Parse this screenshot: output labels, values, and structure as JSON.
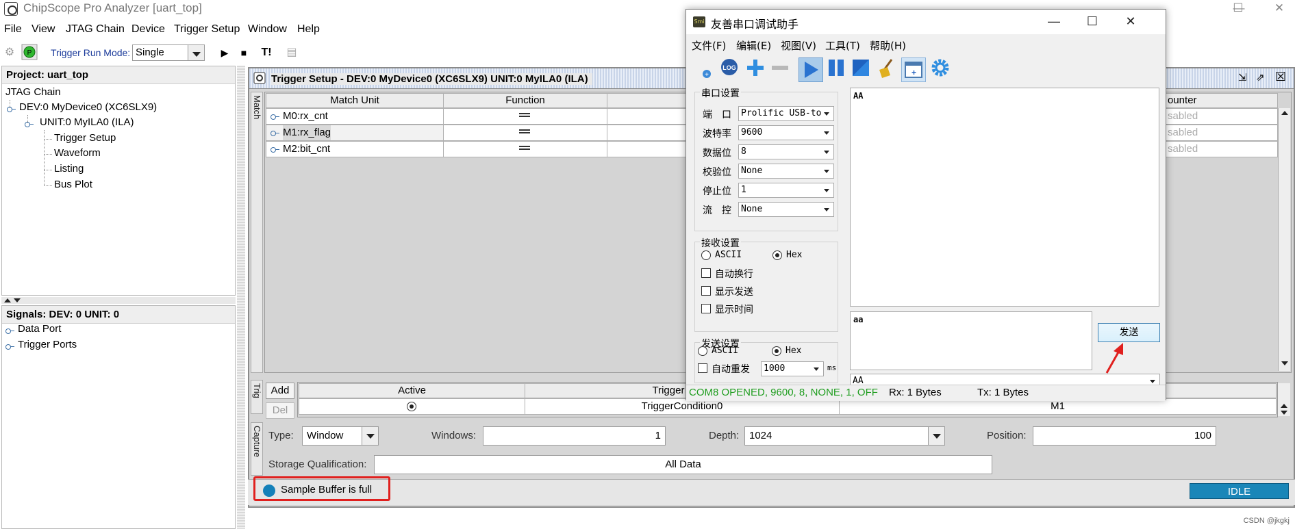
{
  "window": {
    "title": "ChipScope Pro Analyzer [uart_top]",
    "minimize": "—",
    "maximize": "☐",
    "close": "✕"
  },
  "menu": [
    "File",
    "View",
    "JTAG Chain",
    "Device",
    "Trigger Setup",
    "Window",
    "Help"
  ],
  "toolbar": {
    "trigger_mode_label": "Trigger Run Mode:",
    "trigger_mode_value": "Single",
    "run_icon": "▶",
    "stop_icon": "■",
    "trigger_now_label": "T!"
  },
  "project": {
    "header": "Project: uart_top",
    "tree": [
      "JTAG Chain",
      "DEV:0 MyDevice0 (XC6SLX9)",
      "UNIT:0 MyILA0 (ILA)",
      "Trigger Setup",
      "Waveform",
      "Listing",
      "Bus Plot"
    ]
  },
  "signals": {
    "header": "Signals: DEV: 0 UNIT: 0",
    "items": [
      "Data Port",
      "Trigger Ports"
    ]
  },
  "trigger_setup": {
    "title": "Trigger Setup - DEV:0 MyDevice0 (XC6SLX9) UNIT:0 MyILA0 (ILA)",
    "tab_match": "Match",
    "tab_trig": "Trig",
    "tab_capture": "Capture",
    "match_headers": [
      "Match Unit",
      "Function",
      "ounter"
    ],
    "match_rows": [
      {
        "unit": "M0:rx_cnt",
        "counter": "sabled"
      },
      {
        "unit": "M1:rx_flag",
        "counter": "sabled"
      },
      {
        "unit": "M2:bit_cnt",
        "counter": "sabled"
      }
    ],
    "add": "Add",
    "del": "Del",
    "trig_headers": [
      "Active",
      "Trigger Cond"
    ],
    "trig_row": {
      "condition": "TriggerCondition0",
      "equation": "M1"
    },
    "capture": {
      "type_label": "Type:",
      "type_value": "Window",
      "windows_label": "Windows:",
      "windows_value": "1",
      "depth_label": "Depth:",
      "depth_value": "1024",
      "position_label": "Position:",
      "position_value": "100",
      "storage_label": "Storage Qualification:",
      "storage_value": "All Data"
    },
    "status": "Sample Buffer is full",
    "state": "IDLE"
  },
  "serial": {
    "title": "友善串口调试助手",
    "icon_text": "Smi",
    "menu": [
      "文件(F)",
      "编辑(E)",
      "视图(V)",
      "工具(T)",
      "帮助(H)"
    ],
    "log_label": "LOG",
    "port_group": "串口设置",
    "port_fields": [
      {
        "label": "端　口",
        "value": "Prolific USB-to"
      },
      {
        "label": "波特率",
        "value": "9600"
      },
      {
        "label": "数据位",
        "value": "8"
      },
      {
        "label": "校验位",
        "value": "None"
      },
      {
        "label": "停止位",
        "value": "1"
      },
      {
        "label": "流　控",
        "value": "None"
      }
    ],
    "recv_group": "接收设置",
    "recv_ascii": "ASCII",
    "recv_hex": "Hex",
    "recv_checks": [
      "自动换行",
      "显示发送",
      "显示时间"
    ],
    "send_group": "发送设置",
    "send_ascii": "ASCII",
    "send_hex": "Hex",
    "auto_resend": "自动重发",
    "interval_value": "1000",
    "interval_unit": "ms",
    "recv_text": "AA",
    "send_text": "aa",
    "send_button": "发送",
    "history_value": "AA",
    "status_port": "COM8 OPENED, 9600, 8, NONE, 1, OFF",
    "status_rx": "Rx: 1 Bytes",
    "status_tx": "Tx: 1 Bytes",
    "status_color": "#1f9d1f"
  },
  "watermark": "CSDN @jkgkj"
}
